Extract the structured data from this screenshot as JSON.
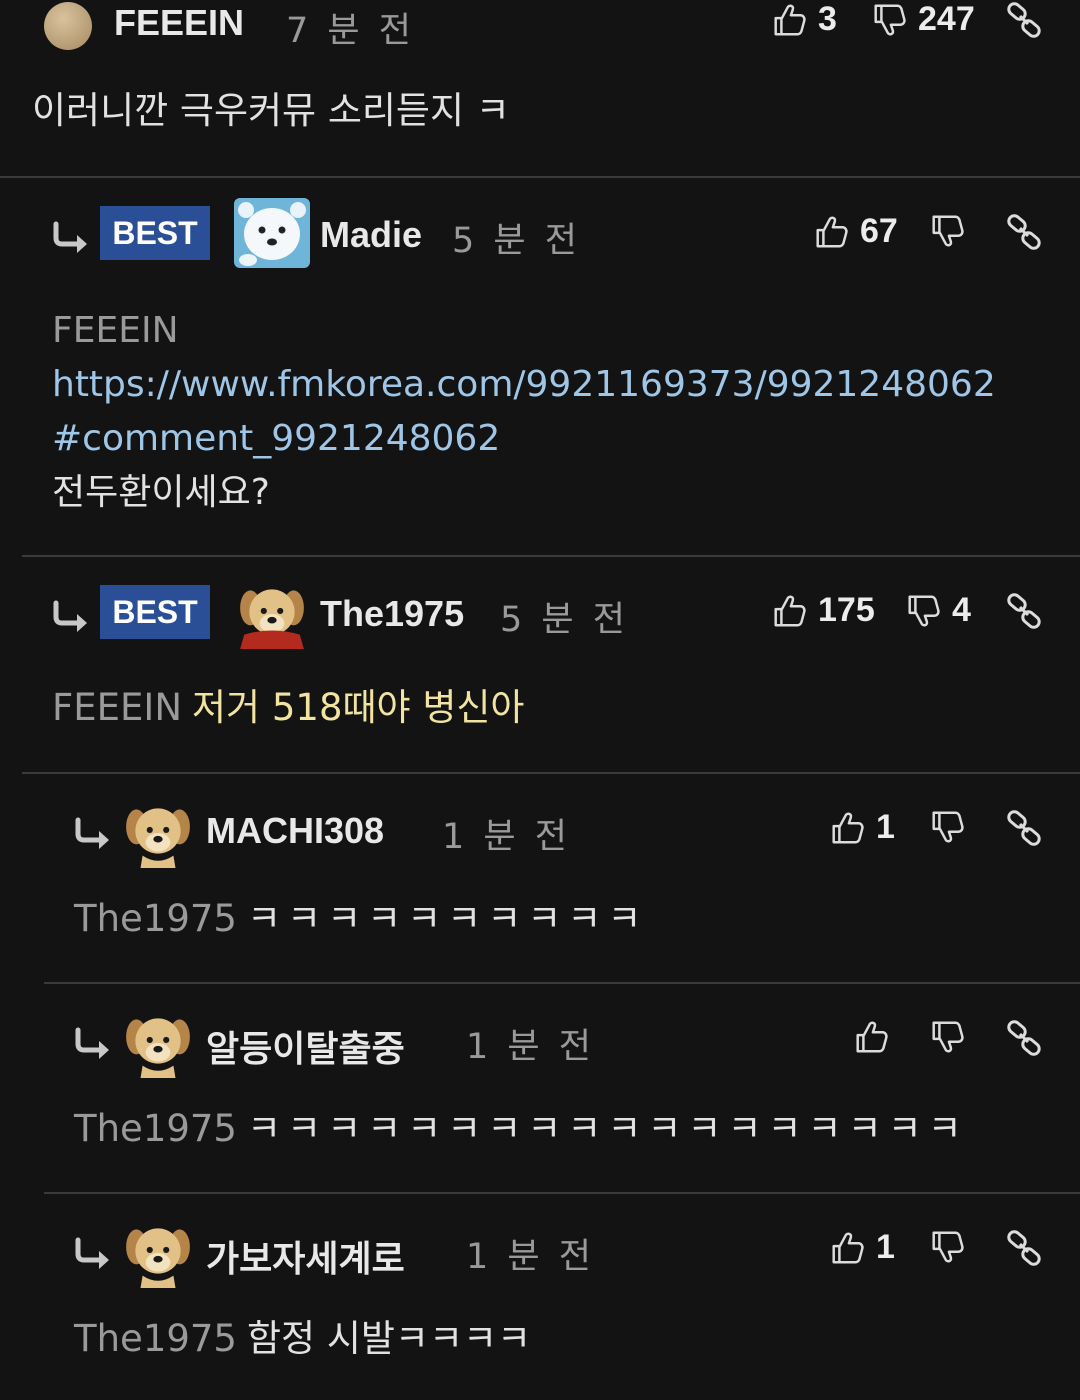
{
  "comments": [
    {
      "nick": "FEEEIN",
      "time": "7 분 전",
      "up": "3",
      "down": "247",
      "text": "이러니깐 극우커뮤 소리듣지 ㅋ"
    },
    {
      "badge": "BEST",
      "nick": "Madie",
      "time": "5 분 전",
      "up": "67",
      "down": "",
      "mention": "FEEEIN",
      "url_line1": "https://www.fmkorea.com/9921169373/9921248062",
      "url_line2": "#comment_9921248062",
      "text": "전두환이세요?"
    },
    {
      "badge": "BEST",
      "nick": "The1975",
      "time": "5 분 전",
      "up": "175",
      "down": "4",
      "mention": "FEEEIN",
      "text": "저거 518때야 병신아"
    },
    {
      "nick": "MACHI308",
      "time": "1 분 전",
      "up": "1",
      "down": "",
      "mention": "The1975",
      "text": "ㅋㅋㅋㅋㅋㅋㅋㅋㅋㅋ"
    },
    {
      "nick": "알등이탈출중",
      "time": "1 분 전",
      "up": "",
      "down": "",
      "mention": "The1975",
      "text": "ㅋㅋㅋㅋㅋㅋㅋㅋㅋㅋㅋㅋㅋㅋㅋㅋㅋㅋ"
    },
    {
      "nick": "가보자세계로",
      "time": "1 분 전",
      "up": "1",
      "down": "",
      "mention": "The1975",
      "text": "함정 시발ㅋㅋㅋㅋ"
    }
  ],
  "icons": {
    "upvote": "thumbs-up-icon",
    "downvote": "thumbs-down-icon",
    "link": "link-icon",
    "reply": "reply-arrow-icon"
  },
  "colors": {
    "background": "#131313",
    "best_badge": "#2a4f97",
    "link": "#9fc6e6",
    "highlight": "#f1e3a0",
    "muted": "#9a9a9a"
  }
}
